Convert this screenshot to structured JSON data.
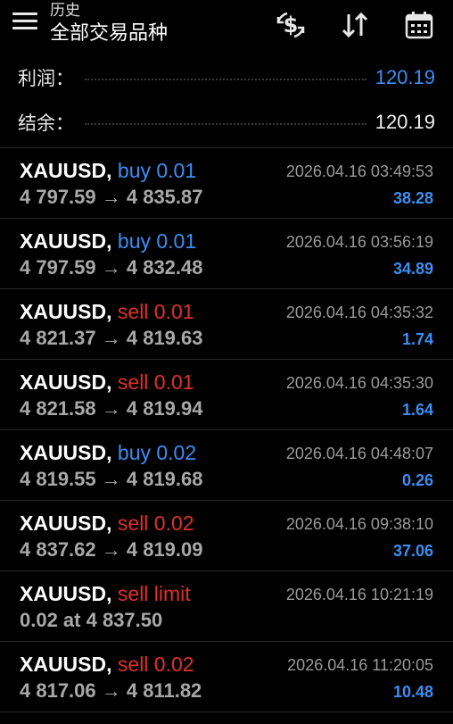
{
  "header": {
    "subtitle": "历史",
    "title": "全部交易品种",
    "icons": [
      "menu-icon",
      "currency-exchange-icon",
      "sort-icon",
      "calendar-icon"
    ]
  },
  "summary": {
    "profit_label": "利润：",
    "profit_value": "120.19",
    "balance_label": "结余：",
    "balance_value": "120.19"
  },
  "colors": {
    "buy": "#3d8ef2",
    "sell": "#e0302a",
    "profit": "#3d8ef2",
    "background": "#000000"
  },
  "trades": [
    {
      "symbol": "XAUUSD,",
      "side": "buy 0.01",
      "side_color": "blue",
      "prices": "4 797.59 → 4 835.87",
      "time": "2026.04.16 03:49:53",
      "profit": "38.28"
    },
    {
      "symbol": "XAUUSD,",
      "side": "buy 0.01",
      "side_color": "blue",
      "prices": "4 797.59 → 4 832.48",
      "time": "2026.04.16 03:56:19",
      "profit": "34.89"
    },
    {
      "symbol": "XAUUSD,",
      "side": "sell 0.01",
      "side_color": "red",
      "prices": "4 821.37 → 4 819.63",
      "time": "2026.04.16 04:35:32",
      "profit": "1.74"
    },
    {
      "symbol": "XAUUSD,",
      "side": "sell 0.01",
      "side_color": "red",
      "prices": "4 821.58 → 4 819.94",
      "time": "2026.04.16 04:35:30",
      "profit": "1.64"
    },
    {
      "symbol": "XAUUSD,",
      "side": "buy 0.02",
      "side_color": "blue",
      "prices": "4 819.55 → 4 819.68",
      "time": "2026.04.16 04:48:07",
      "profit": "0.26"
    },
    {
      "symbol": "XAUUSD,",
      "side": "sell 0.02",
      "side_color": "red",
      "prices": "4 837.62 → 4 819.09",
      "time": "2026.04.16 09:38:10",
      "profit": "37.06"
    },
    {
      "symbol": "XAUUSD,",
      "side": "sell limit",
      "side_color": "red",
      "prices": "0.02 at 4 837.50",
      "time": "2026.04.16 10:21:19",
      "profit": ""
    },
    {
      "symbol": "XAUUSD,",
      "side": "sell 0.02",
      "side_color": "red",
      "prices": "4 817.06 → 4 811.82",
      "time": "2026.04.16 11:20:05",
      "profit": "10.48"
    }
  ]
}
